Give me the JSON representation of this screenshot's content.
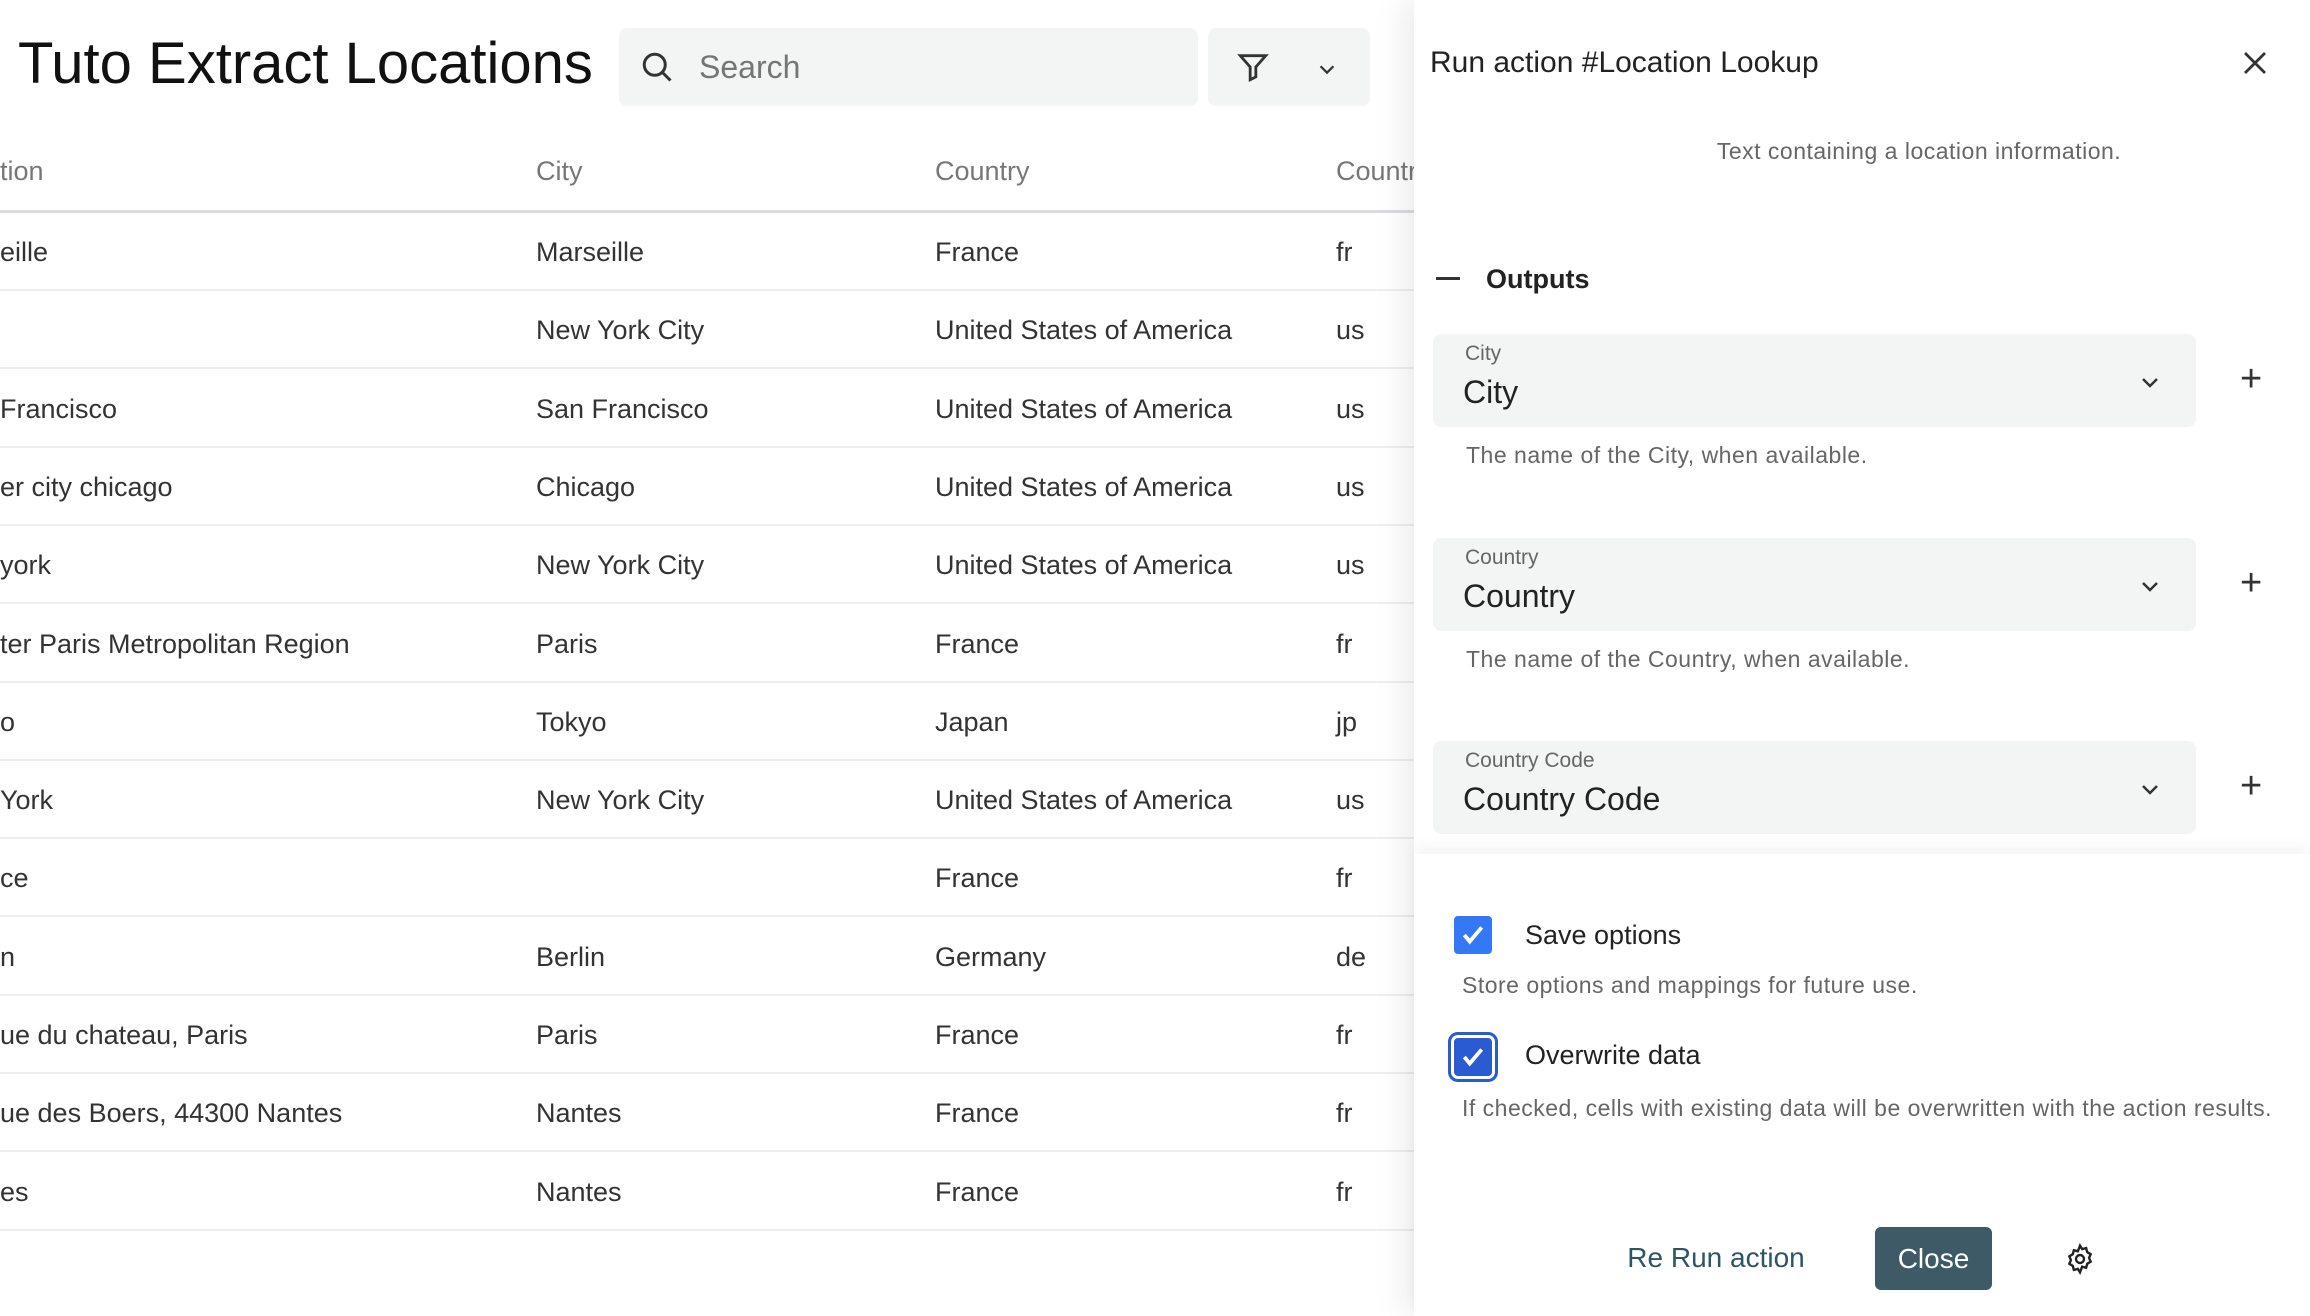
{
  "header": {
    "title": "Tuto Extract Locations I",
    "search_placeholder": "Search"
  },
  "table": {
    "columns": [
      "tion",
      "City",
      "Country",
      "Countr"
    ],
    "rows": [
      [
        "eille",
        "Marseille",
        "France",
        "fr"
      ],
      [
        "",
        "New York City",
        "United States of America",
        "us"
      ],
      [
        "Francisco",
        "San Francisco",
        "United States of America",
        "us"
      ],
      [
        "er city chicago",
        "Chicago",
        "United States of America",
        "us"
      ],
      [
        "york",
        "New York City",
        "United States of America",
        "us"
      ],
      [
        "ter Paris Metropolitan Region",
        "Paris",
        "France",
        "fr"
      ],
      [
        "o",
        "Tokyo",
        "Japan",
        "jp"
      ],
      [
        "York",
        "New York City",
        "United States of America",
        "us"
      ],
      [
        "ce",
        "",
        "France",
        "fr"
      ],
      [
        "n",
        "Berlin",
        "Germany",
        "de"
      ],
      [
        "ue du chateau, Paris",
        "Paris",
        "France",
        "fr"
      ],
      [
        "ue des Boers, 44300 Nantes",
        "Nantes",
        "France",
        "fr"
      ],
      [
        "es",
        "Nantes",
        "France",
        "fr"
      ]
    ]
  },
  "panel": {
    "title": "Run action #Location Lookup",
    "input_description": "Text containing a location information.",
    "outputs_label": "Outputs",
    "outputs": [
      {
        "label": "City",
        "value": "City",
        "description": "The name of the City, when available."
      },
      {
        "label": "Country",
        "value": "Country",
        "description": "The name of the Country, when available."
      },
      {
        "label": "Country Code",
        "value": "Country Code"
      }
    ],
    "save_options": {
      "label": "Save options",
      "checked": true,
      "description": "Store options and mappings for future use."
    },
    "overwrite": {
      "label": "Overwrite data",
      "checked": true,
      "description": "If checked, cells with existing data will be overwritten with the action results."
    },
    "rerun_label": "Re Run action",
    "close_label": "Close"
  },
  "colors": {
    "accent": "#3478f6",
    "close_button": "#3d5a66",
    "rerun_text": "#2f5563"
  }
}
